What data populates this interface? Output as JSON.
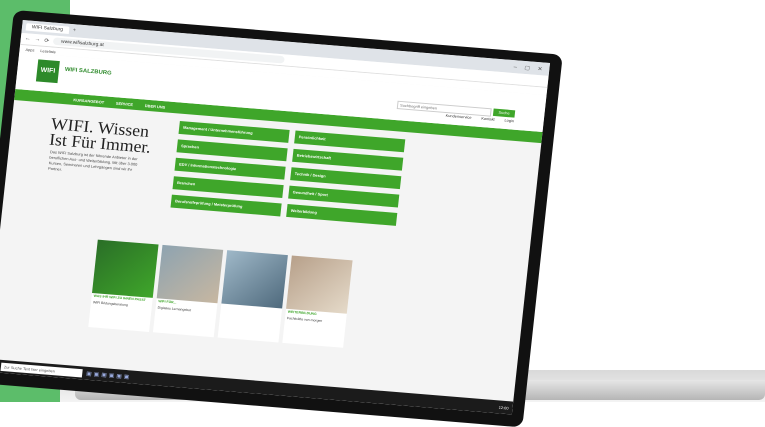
{
  "browser": {
    "tab": "WIFI Salzburg",
    "url": "www.wifisalzburg.at",
    "bookmarks": [
      "Apps",
      "Leseliste"
    ]
  },
  "site": {
    "logo_text": "WIFI",
    "brand": "WIFI SALZBURG",
    "util_links": [
      "Kundenservice",
      "Kontakt",
      "Login"
    ],
    "nav": [
      "KURSANGEBOT",
      "SERVICE",
      "ÜBER UNS"
    ],
    "search_placeholder": "Suchbegriff eingeben",
    "search_button": "Suche"
  },
  "hero": {
    "title": "WIFI. Wissen Ist Für Immer.",
    "text": "Das WIFI Salzburg ist der führende Anbieter in der beruflichen Aus- und Weiterbildung. Mit über 3.000 Kursen, Seminaren und Lehrgängen sind wir Ihr Partner."
  },
  "categories": [
    "Management / Unternehmensführung",
    "Persönlichkeit",
    "Sprachen",
    "Betriebswirtschaft",
    "EDV / Informationstechnologie",
    "Technik / Design",
    "Branchen",
    "Gesundheit / Sport",
    "Berufsreifeprüfung / Meisterprüfung",
    "Weiterbildung"
  ],
  "promos": [
    {
      "image": "wifi-green-panel",
      "heading": "WAS IHR WIFI ZU IHNEN PASST",
      "caption": "WIFI Bildungsberatung"
    },
    {
      "image": "two-people",
      "heading": "WIFI FÜR...",
      "caption": "Digitales Lernangebot"
    },
    {
      "image": "office-team",
      "heading": "",
      "caption": ""
    },
    {
      "image": "team-meeting",
      "heading": "WEITERBILDUNG",
      "caption": "Fachkräfte von morgen"
    }
  ],
  "taskbar": {
    "search": "Zur Suche Text hier eingeben",
    "time": "12:00"
  }
}
